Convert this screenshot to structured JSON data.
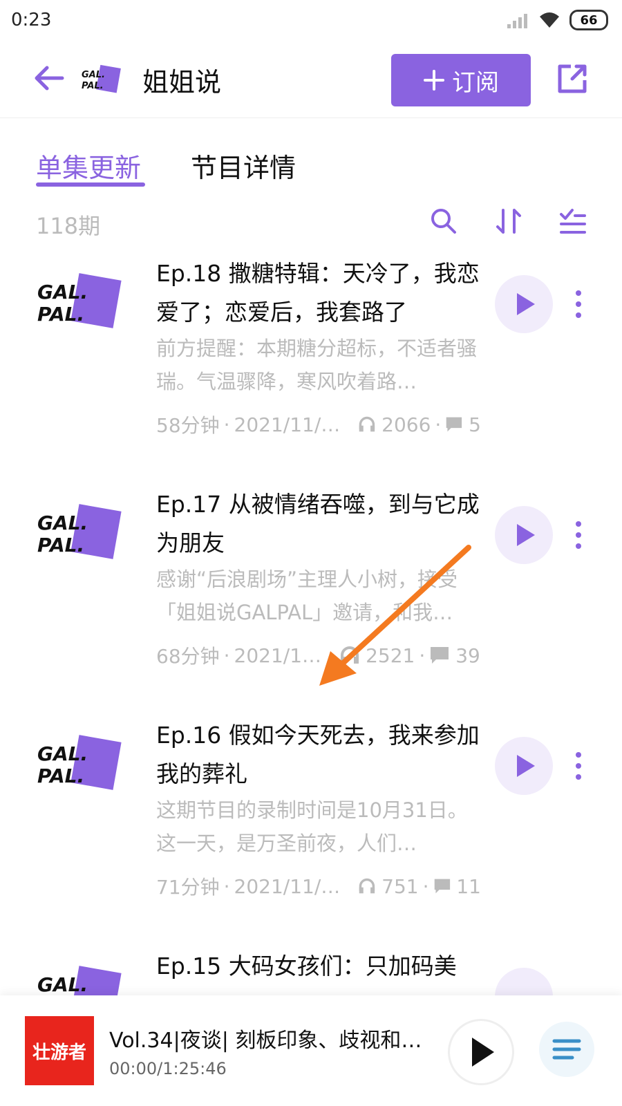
{
  "status": {
    "time": "0:23",
    "battery": "66"
  },
  "header": {
    "title": "姐姐说",
    "subscribe_label": "订阅"
  },
  "tabs": [
    {
      "label": "单集更新"
    },
    {
      "label": "节目详情"
    }
  ],
  "toolbar": {
    "count": "118期"
  },
  "episodes": [
    {
      "title": "Ep.18 撒糖特辑：天冷了，我恋爱了；恋爱后，我套路了",
      "desc": "前方提醒：本期糖分超标，不适者骚瑞。气温骤降，寒风吹着路…",
      "duration": "58分钟",
      "date": "2021/11/…",
      "plays": "2066",
      "comments": "5"
    },
    {
      "title": "Ep.17 从被情绪吞噬，到与它成为朋友",
      "desc": "感谢“后浪剧场”主理人小树，接受「姐姐说GALPAL」邀请，和我…",
      "duration": "68分钟",
      "date": "2021/1…",
      "plays": "2521",
      "comments": "39"
    },
    {
      "title": "Ep.16 假如今天死去，我来参加我的葬礼",
      "desc": "这期节目的录制时间是10月31日。这一天，是万圣前夜，人们…",
      "duration": "71分钟",
      "date": "2021/11/…",
      "plays": "751",
      "comments": "11"
    },
    {
      "title": "Ep.15 大码女孩们：只加码美"
    }
  ],
  "player": {
    "cover_text": "壮游者",
    "title": "Vol.34|夜谈| 刻板印象、歧视和…",
    "time": "00:00/1:25:46"
  },
  "colors": {
    "accent": "#8a63e0",
    "arrow": "#f47a20"
  }
}
